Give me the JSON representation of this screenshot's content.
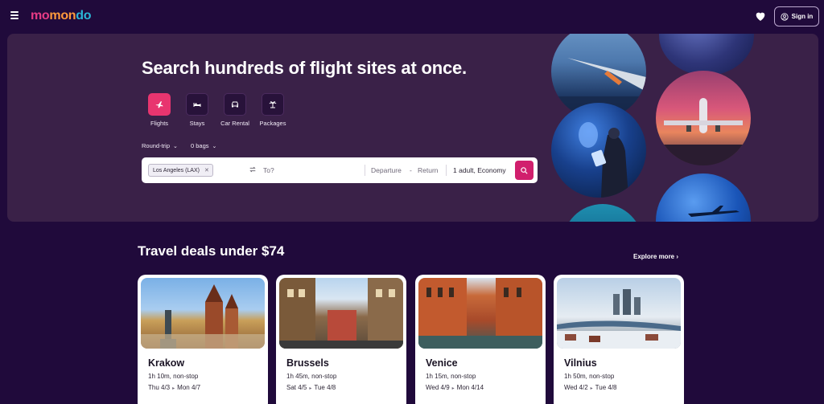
{
  "header": {
    "logo": {
      "part1": "mo",
      "part2": "mon",
      "part3": "do"
    },
    "signin_label": "Sign in",
    "icons": {
      "menu": "hamburger-icon",
      "favorites": "heart-icon",
      "account": "user-circle-icon"
    }
  },
  "hero": {
    "title": "Search hundreds of flight sites at once.",
    "verticals": [
      {
        "label": "Flights",
        "icon": "plane-icon",
        "active": true
      },
      {
        "label": "Stays",
        "icon": "bed-icon",
        "active": false
      },
      {
        "label": "Car Rental",
        "icon": "car-icon",
        "active": false
      },
      {
        "label": "Packages",
        "icon": "palm-icon",
        "active": false
      }
    ],
    "trip_type": "Round-trip",
    "bags": "0 bags",
    "search": {
      "origin": "Los Angeles (LAX)",
      "destination_placeholder": "To?",
      "departure_placeholder": "Departure",
      "date_separator": "-",
      "return_placeholder": "Return",
      "travelers": "1 adult, Economy"
    }
  },
  "deals": {
    "title": "Travel deals under $74",
    "explore_label": "Explore more",
    "cards": [
      {
        "city": "Krakow",
        "duration": "1h 10m, non-stop",
        "depart": "Thu 4/3",
        "return": "Mon 4/7"
      },
      {
        "city": "Brussels",
        "duration": "1h 45m, non-stop",
        "depart": "Sat 4/5",
        "return": "Tue 4/8"
      },
      {
        "city": "Venice",
        "duration": "1h 15m, non-stop",
        "depart": "Wed 4/9",
        "return": "Mon 4/14"
      },
      {
        "city": "Vilnius",
        "duration": "1h 50m, non-stop",
        "depart": "Wed 4/2",
        "return": "Tue 4/8"
      }
    ]
  },
  "colors": {
    "background": "#200a3b",
    "hero": "#3a2148",
    "accent": "#e8356f",
    "search_button": "#d11f6d"
  }
}
